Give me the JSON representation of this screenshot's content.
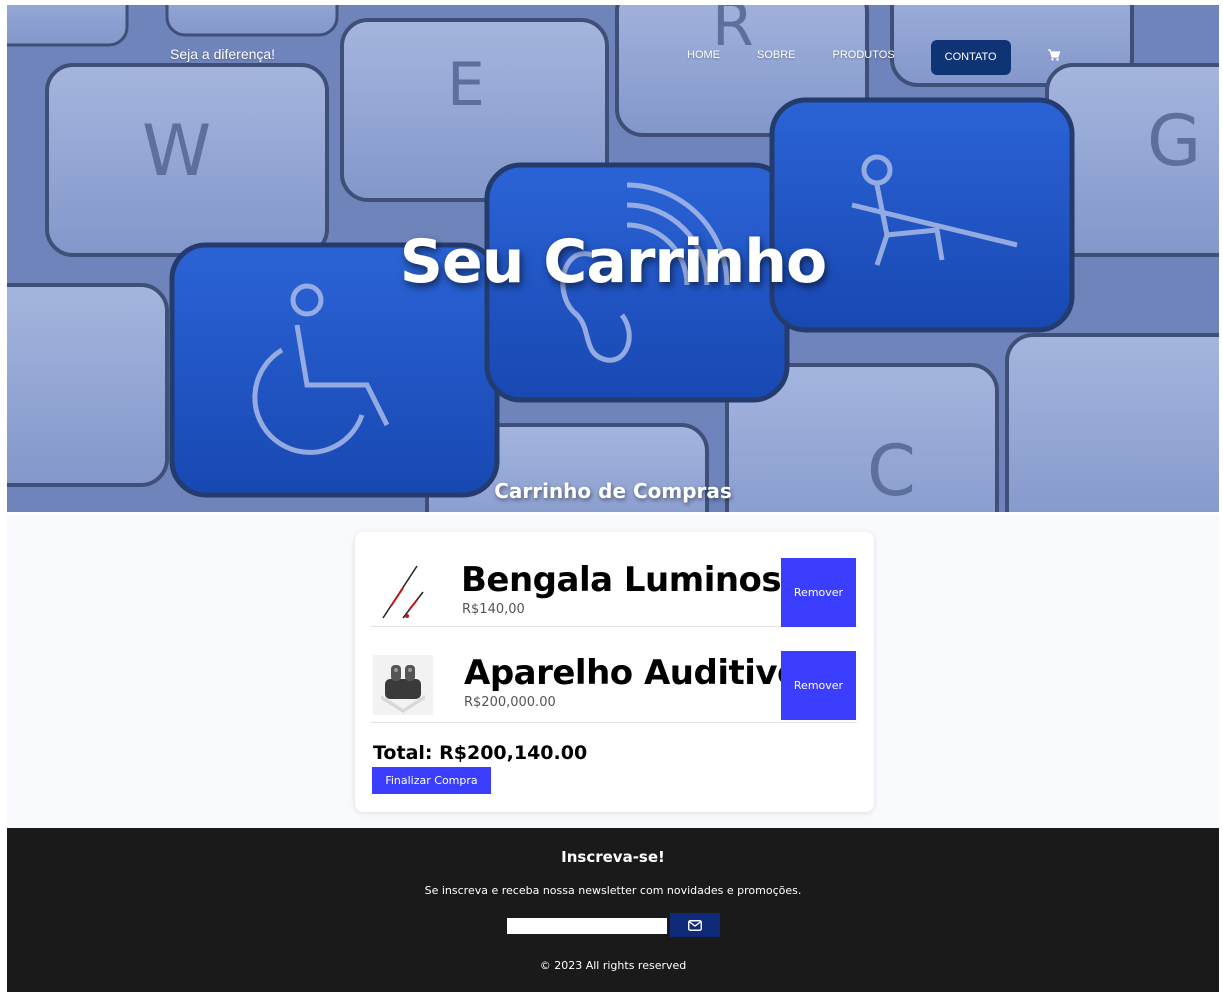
{
  "nav": {
    "brand": "Seja a diferença!",
    "links": [
      "HOME",
      "SOBRE",
      "PRODUTOS"
    ],
    "contact_label": "CONTATO",
    "cart_icon": "shopping-cart-icon"
  },
  "hero": {
    "title": "Seu Carrinho",
    "subtitle": "Carrinho de Compras"
  },
  "cart": {
    "items": [
      {
        "name": "Bengala Luminosa",
        "price": "R$140,00",
        "remove_label": "Remover",
        "thumb": "white-cane-image"
      },
      {
        "name": "Aparelho Auditivo",
        "price": "R$200,000.00",
        "remove_label": "Remover",
        "thumb": "hearing-aid-image"
      }
    ],
    "total": "Total: R$200,140.00",
    "checkout_label": "Finalizar Compra"
  },
  "footer": {
    "title": "Inscreva-se!",
    "text": "Se inscreva e receba nossa newsletter com novidades e promoções.",
    "newsletter_placeholder": "",
    "submit_icon": "envelope-icon",
    "copyright": "© 2023 All rights reserved"
  },
  "colors": {
    "accent": "#3b3eff",
    "nav_button": "#0f3475",
    "footer_bg": "#1a1a1a",
    "hero_blue_key": "#1f56c6",
    "hero_gray_key": "#8ea2d2"
  }
}
